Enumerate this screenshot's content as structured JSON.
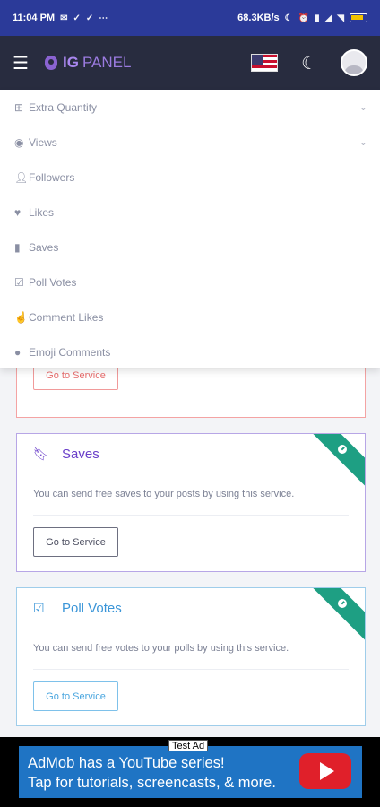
{
  "status_bar": {
    "time": "11:04 PM",
    "network_speed": "68.3KB/s",
    "battery_level": "low",
    "icons": [
      "mail-icon",
      "check-download-icon",
      "check-download-icon",
      "more-dots-icon",
      "moon-icon",
      "alarm-icon",
      "vibrate-icon",
      "signal-icon",
      "wifi-icon",
      "battery-icon"
    ]
  },
  "header": {
    "logo_bold": "IG",
    "logo_light": "PANEL",
    "menu_icon": "hamburger-icon",
    "language_icon": "us-flag-icon",
    "theme_icon": "moon-icon",
    "avatar_icon": "user-avatar-icon"
  },
  "menu": {
    "items": [
      {
        "label": "Extra Quantity",
        "icon": "plus-square-icon",
        "has_submenu": true
      },
      {
        "label": "Views",
        "icon": "eye-icon",
        "has_submenu": true
      },
      {
        "label": "Followers",
        "icon": "user-plus-icon",
        "has_submenu": false
      },
      {
        "label": "Likes",
        "icon": "heart-icon",
        "has_submenu": false
      },
      {
        "label": "Saves",
        "icon": "bookmark-icon",
        "has_submenu": false
      },
      {
        "label": "Poll Votes",
        "icon": "vote-icon",
        "has_submenu": false
      },
      {
        "label": "Comment Likes",
        "icon": "hand-heart-icon",
        "has_submenu": false
      },
      {
        "label": "Emoji Comments",
        "icon": "comment-icon",
        "has_submenu": false
      }
    ]
  },
  "cards": [
    {
      "title": "",
      "description": "",
      "button": "Go to Service",
      "accent": "#e86d6d"
    },
    {
      "title": "Saves",
      "description": "You can send free saves to your posts by using this service.",
      "button": "Go to Service",
      "accent": "#6a3fc9",
      "icon": "bookmark-icon",
      "badge_icon": "clock-icon"
    },
    {
      "title": "Poll Votes",
      "description": "You can send free votes to your polls by using this service.",
      "button": "Go to Service",
      "accent": "#3a95d8",
      "icon": "vote-icon",
      "badge_icon": "clock-icon"
    }
  ],
  "ad": {
    "label": "Test Ad",
    "line1": "AdMob has a YouTube series!",
    "line2": "Tap for tutorials, screencasts, & more.",
    "icon": "youtube-play-icon"
  },
  "colors": {
    "status_bar": "#2b3a99",
    "header": "#282c3f",
    "badge": "#1e9f83",
    "ad_banner": "#1f74c4"
  }
}
